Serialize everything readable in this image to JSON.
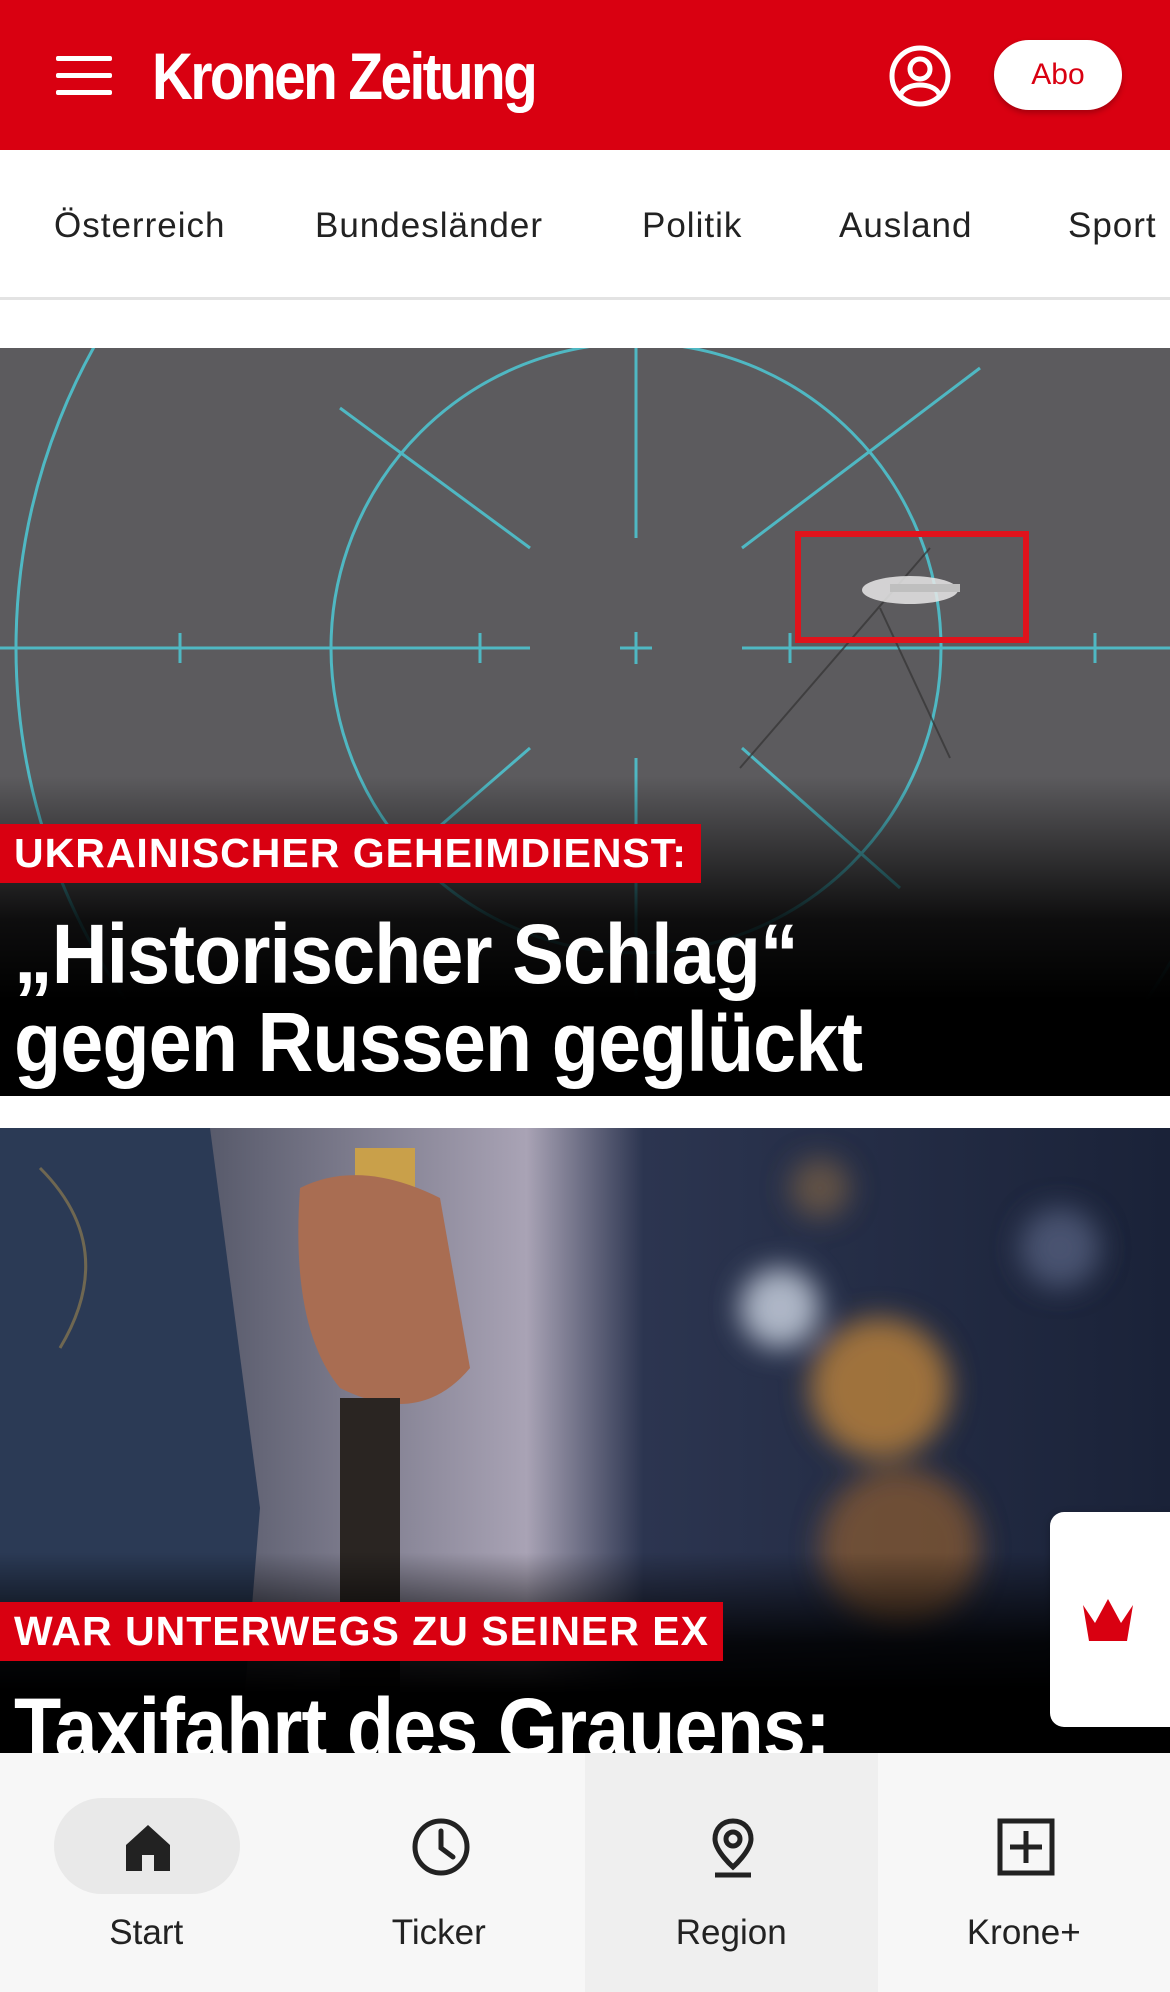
{
  "header": {
    "logo_text": "Kronen Zeitung",
    "abo_label": "Abo",
    "brand_color": "#d90011",
    "icons": [
      "menu-icon",
      "account-icon"
    ]
  },
  "nav": {
    "items": [
      "Österreich",
      "Bundesländer",
      "Politik",
      "Ausland",
      "Sport"
    ]
  },
  "teasers": [
    {
      "kicker": "UKRAINISCHER GEHEIMDIENST:",
      "headline_line1": "„Historischer Schlag“",
      "headline_line2": "gegen Russen geglückt"
    },
    {
      "kicker": "WAR UNTERWEGS ZU SEINER EX",
      "headline_line1": "Taxifahrt des Grauens:"
    }
  ],
  "side_widget": {
    "icon": "krone-crown-icon"
  },
  "bottom_nav": {
    "tabs": [
      {
        "label": "Start",
        "icon": "home-icon",
        "active": true
      },
      {
        "label": "Ticker",
        "icon": "clock-icon"
      },
      {
        "label": "Region",
        "icon": "location-pin-icon"
      },
      {
        "label": "Krone+",
        "icon": "plus-box-icon"
      }
    ]
  }
}
